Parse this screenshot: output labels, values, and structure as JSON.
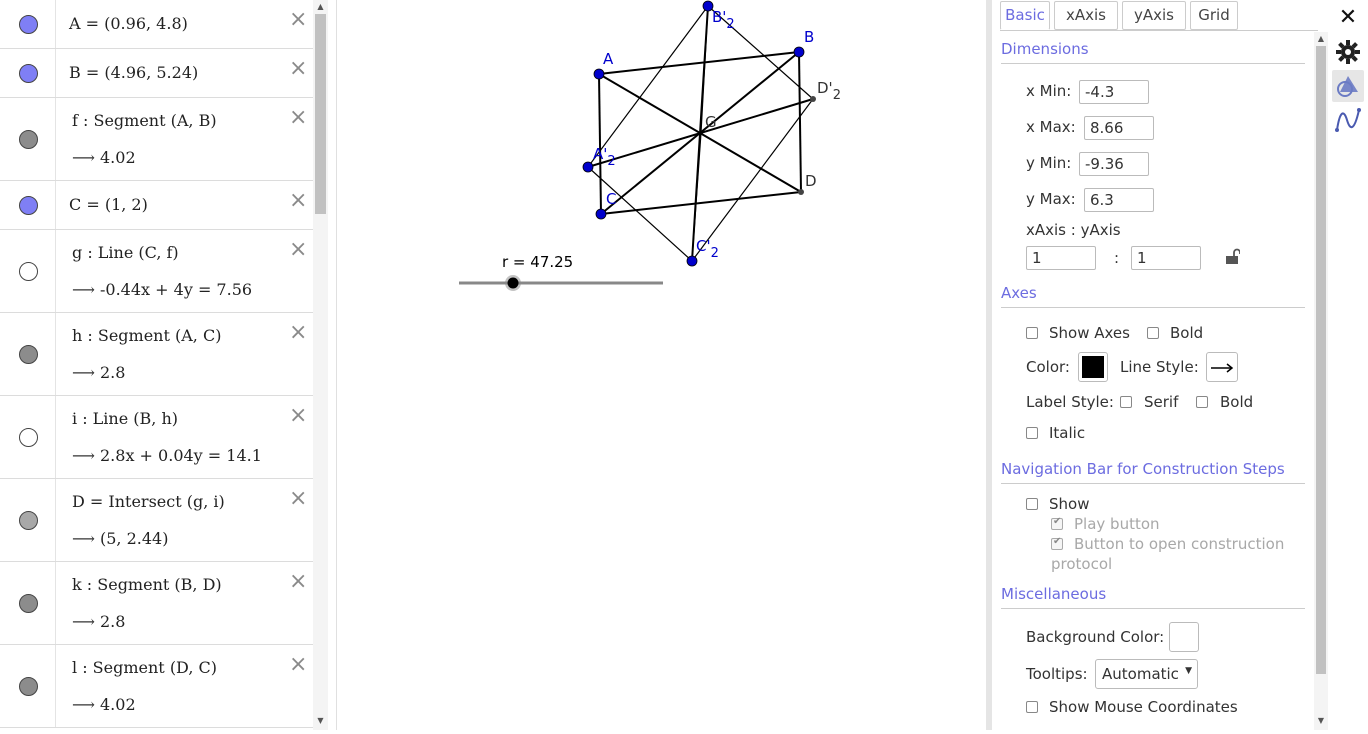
{
  "algebra": {
    "rows": [
      {
        "def": "A = (0.96, 4.8)",
        "value": "",
        "marble": "#7f7ff5",
        "plain": true
      },
      {
        "def": "B = (4.96, 5.24)",
        "value": "",
        "marble": "#7f7ff5",
        "plain": true
      },
      {
        "def": "f : Segment (A, B)",
        "value": "4.02",
        "marble": "#8c8c8c"
      },
      {
        "def": "C = (1, 2)",
        "value": "",
        "marble": "#7f7ff5",
        "plain": true
      },
      {
        "def": "g : Line (C, f)",
        "value": "-0.44x + 4y = 7.56",
        "marble": "#ffffff"
      },
      {
        "def": "h : Segment (A, C)",
        "value": "2.8",
        "marble": "#8c8c8c"
      },
      {
        "def": "i : Line (B, h)",
        "value": "2.8x + 0.04y = 14.1",
        "marble": "#ffffff"
      },
      {
        "def": "D = Intersect (g, i)",
        "value": "(5, 2.44)",
        "marble": "#a8a8a8"
      },
      {
        "def": "k : Segment (B, D)",
        "value": "2.8",
        "marble": "#8c8c8c"
      },
      {
        "def": "l : Segment (D, C)",
        "value": "4.02",
        "marble": "#8c8c8c"
      }
    ],
    "arrow": "⟶",
    "delete_icon": "×"
  },
  "graphics": {
    "slider_label": "r = 47.25",
    "slider_value": 47.25,
    "points": [
      {
        "name": "A",
        "label": "A",
        "sub": ""
      },
      {
        "name": "B",
        "label": "B",
        "sub": ""
      },
      {
        "name": "C",
        "label": "C",
        "sub": ""
      },
      {
        "name": "D",
        "label": "D",
        "sub": ""
      },
      {
        "name": "G",
        "label": "G",
        "sub": ""
      },
      {
        "name": "A2",
        "label": "A'",
        "sub": "2"
      },
      {
        "name": "B2",
        "label": "B'",
        "sub": "2"
      },
      {
        "name": "C2",
        "label": "C'",
        "sub": "2"
      },
      {
        "name": "D2",
        "label": "D'",
        "sub": "2"
      }
    ],
    "colors": {
      "free_point": "#0000cc",
      "dependent": "#444444",
      "line": "#000000"
    }
  },
  "props": {
    "tabs": [
      "Basic",
      "xAxis",
      "yAxis",
      "Grid"
    ],
    "active_tab": "Basic",
    "dimensions": {
      "title": "Dimensions",
      "xmin_label": "x Min:",
      "xmin": "-4.3",
      "xmax_label": "x Max:",
      "xmax": "8.66",
      "ymin_label": "y Min:",
      "ymin": "-9.36",
      "ymax_label": "y Max:",
      "ymax": "6.3",
      "ratio_label": "xAxis : yAxis",
      "ratio_x": "1",
      "ratio_sep": ":",
      "ratio_y": "1"
    },
    "axes": {
      "title": "Axes",
      "show_axes": "Show Axes",
      "bold": "Bold",
      "color_label": "Color:",
      "line_style_label": "Line Style:",
      "label_style_label": "Label Style:",
      "serif": "Serif",
      "bold2": "Bold",
      "italic": "Italic"
    },
    "nav": {
      "title": "Navigation Bar for Construction Steps",
      "show": "Show",
      "play_button": "Play button",
      "open_protocol_1": "Button to open construction",
      "open_protocol_2": "protocol"
    },
    "misc": {
      "title": "Miscellaneous",
      "bg_color_label": "Background Color:",
      "tooltips_label": "Tooltips:",
      "tooltips_value": "Automatic",
      "show_mouse_coords": "Show Mouse Coordinates"
    }
  },
  "right_bar": {
    "close_icon": "✕"
  }
}
